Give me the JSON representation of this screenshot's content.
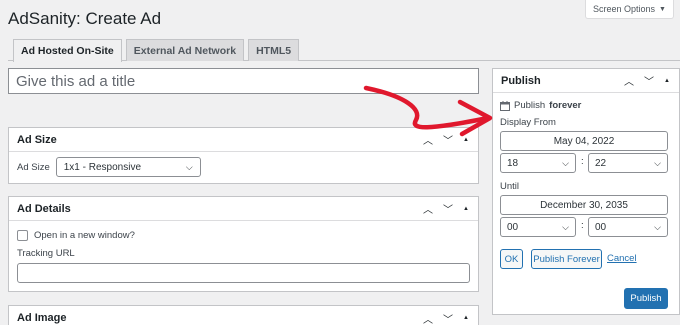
{
  "screen_options": {
    "label": "Screen Options",
    "icon": "caret-down-icon"
  },
  "page_title": "AdSanity: Create Ad",
  "tabs": [
    {
      "label": "Ad Hosted On-Site"
    },
    {
      "label": "External Ad Network"
    },
    {
      "label": "HTML5"
    }
  ],
  "title_input": {
    "placeholder": "Give this ad a title"
  },
  "ad_size": {
    "heading": "Ad Size",
    "field_label": "Ad Size",
    "selected": "1x1 - Responsive"
  },
  "ad_details": {
    "heading": "Ad Details",
    "new_window_label": "Open in a new window?",
    "tracking_url_label": "Tracking URL",
    "tracking_url_value": ""
  },
  "ad_image": {
    "heading": "Ad Image"
  },
  "publish": {
    "heading": "Publish",
    "publish_prefix": "Publish",
    "publish_mode": "forever",
    "display_from_label": "Display From",
    "display_from_date": "May 04, 2022",
    "display_from_hour": "18",
    "display_from_minute": "22",
    "until_label": "Until",
    "until_date": "December 30, 2035",
    "until_hour": "00",
    "until_minute": "00",
    "time_separator": ":",
    "ok_label": "OK",
    "publish_forever_label": "Publish Forever",
    "cancel_label": "Cancel",
    "publish_button_label": "Publish"
  },
  "colors": {
    "accent": "#2271b1",
    "annotation_arrow": "#e0182d",
    "background": "#f0f0f1"
  }
}
